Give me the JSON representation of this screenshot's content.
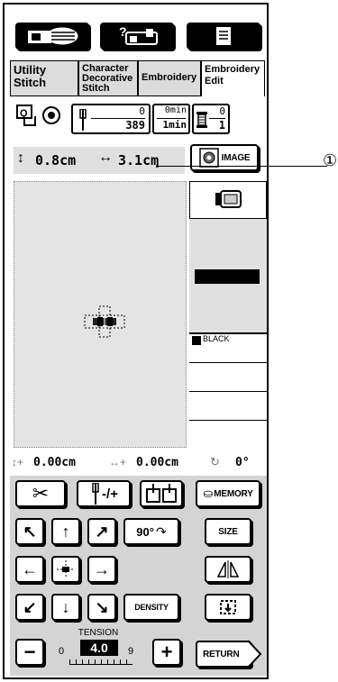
{
  "tabs": {
    "utility": "Utility\nStitch",
    "character": "Character\nDecorative\nStitch",
    "embroidery": "Embroidery",
    "edit": "Embroidery\nEdit"
  },
  "counters": {
    "stitch_current": "0",
    "stitch_total": "389",
    "time_current": "0min",
    "time_total": "1min",
    "color_current": "0",
    "color_total": "1"
  },
  "size": {
    "height": "0.8cm",
    "width": "3.1cm",
    "image_label": "IMAGE"
  },
  "callout": "①",
  "thread": {
    "color_name": "BLACK",
    "swatch_color": "#000000"
  },
  "position": {
    "vertical": "0.00cm",
    "horizontal": "0.00cm",
    "rotation": "0°"
  },
  "buttons": {
    "needle_label": "-/+",
    "memory": "MEMORY",
    "rotate90": "90°",
    "size": "SIZE",
    "density": "DENSITY",
    "return": "RETURN"
  },
  "tension": {
    "label": "TENSION",
    "value": "4.0",
    "min": "0",
    "max": "9",
    "minus": "−",
    "plus": "+"
  }
}
